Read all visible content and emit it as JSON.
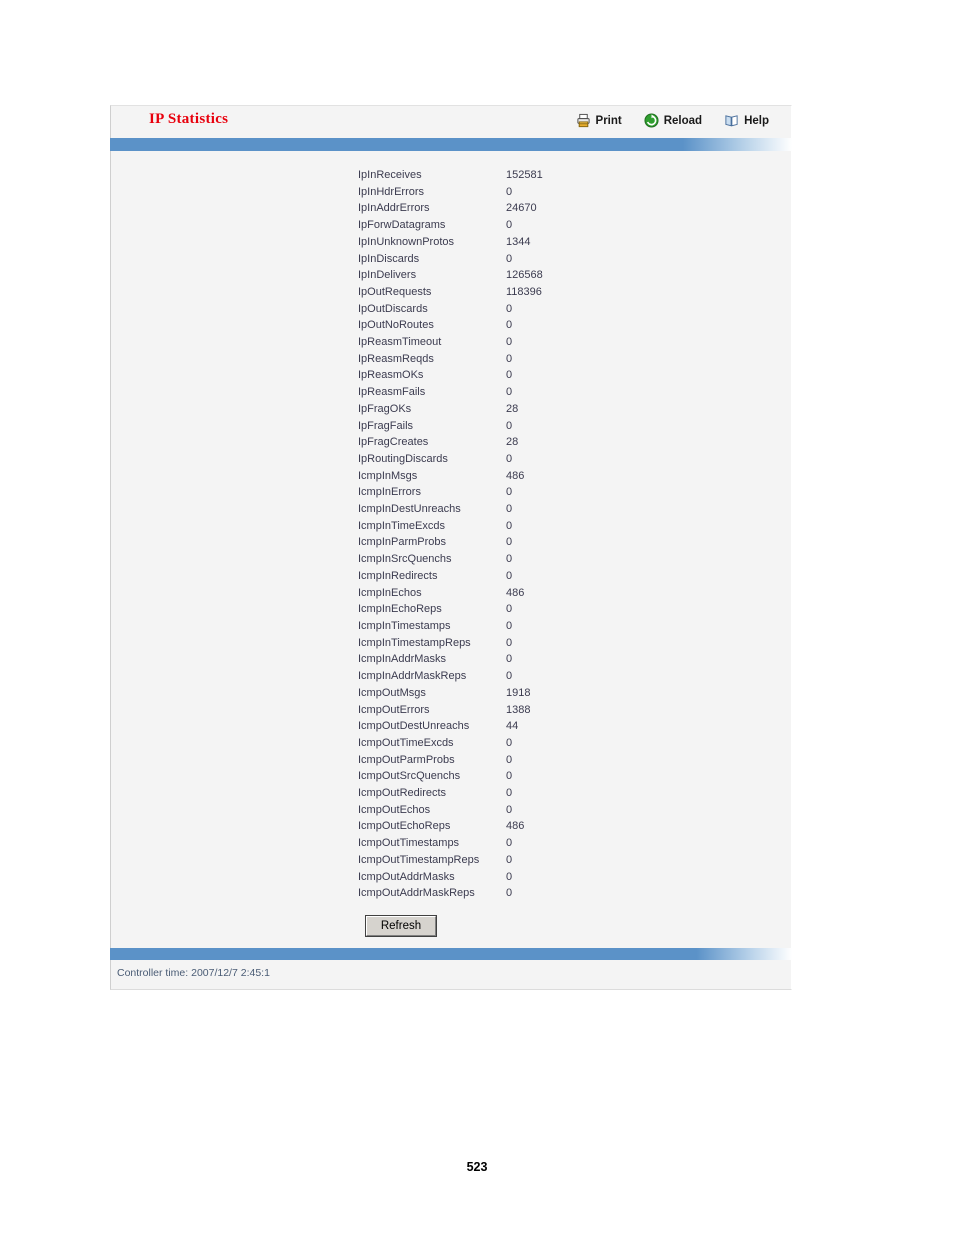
{
  "panel": {
    "title": "IP Statistics",
    "title_color": "#e8000d",
    "accent_color": "#5b92c8",
    "toolbar": [
      {
        "label": "Print",
        "icon": "printer-icon"
      },
      {
        "label": "Reload",
        "icon": "reload-icon"
      },
      {
        "label": "Help",
        "icon": "help-book-icon"
      }
    ],
    "stats": [
      {
        "name": "IpInReceives",
        "value": "152581"
      },
      {
        "name": "IpInHdrErrors",
        "value": "0"
      },
      {
        "name": "IpInAddrErrors",
        "value": "24670"
      },
      {
        "name": "IpForwDatagrams",
        "value": "0"
      },
      {
        "name": "IpInUnknownProtos",
        "value": "1344"
      },
      {
        "name": "IpInDiscards",
        "value": "0"
      },
      {
        "name": "IpInDelivers",
        "value": "126568"
      },
      {
        "name": "IpOutRequests",
        "value": "118396"
      },
      {
        "name": "IpOutDiscards",
        "value": "0"
      },
      {
        "name": "IpOutNoRoutes",
        "value": "0"
      },
      {
        "name": "IpReasmTimeout",
        "value": "0"
      },
      {
        "name": "IpReasmReqds",
        "value": "0"
      },
      {
        "name": "IpReasmOKs",
        "value": "0"
      },
      {
        "name": "IpReasmFails",
        "value": "0"
      },
      {
        "name": "IpFragOKs",
        "value": "28"
      },
      {
        "name": "IpFragFails",
        "value": "0"
      },
      {
        "name": "IpFragCreates",
        "value": "28"
      },
      {
        "name": "IpRoutingDiscards",
        "value": "0"
      },
      {
        "name": "IcmpInMsgs",
        "value": "486"
      },
      {
        "name": "IcmpInErrors",
        "value": "0"
      },
      {
        "name": "IcmpInDestUnreachs",
        "value": "0"
      },
      {
        "name": "IcmpInTimeExcds",
        "value": "0"
      },
      {
        "name": "IcmpInParmProbs",
        "value": "0"
      },
      {
        "name": "IcmpInSrcQuenchs",
        "value": "0"
      },
      {
        "name": "IcmpInRedirects",
        "value": "0"
      },
      {
        "name": "IcmpInEchos",
        "value": "486"
      },
      {
        "name": "IcmpInEchoReps",
        "value": "0"
      },
      {
        "name": "IcmpInTimestamps",
        "value": "0"
      },
      {
        "name": "IcmpInTimestampReps",
        "value": "0"
      },
      {
        "name": "IcmpInAddrMasks",
        "value": "0"
      },
      {
        "name": "IcmpInAddrMaskReps",
        "value": "0"
      },
      {
        "name": "IcmpOutMsgs",
        "value": "1918"
      },
      {
        "name": "IcmpOutErrors",
        "value": "1388"
      },
      {
        "name": "IcmpOutDestUnreachs",
        "value": "44"
      },
      {
        "name": "IcmpOutTimeExcds",
        "value": "0"
      },
      {
        "name": "IcmpOutParmProbs",
        "value": "0"
      },
      {
        "name": "IcmpOutSrcQuenchs",
        "value": "0"
      },
      {
        "name": "IcmpOutRedirects",
        "value": "0"
      },
      {
        "name": "IcmpOutEchos",
        "value": "0"
      },
      {
        "name": "IcmpOutEchoReps",
        "value": "486"
      },
      {
        "name": "IcmpOutTimestamps",
        "value": "0"
      },
      {
        "name": "IcmpOutTimestampReps",
        "value": "0"
      },
      {
        "name": "IcmpOutAddrMasks",
        "value": "0"
      },
      {
        "name": "IcmpOutAddrMaskReps",
        "value": "0"
      }
    ],
    "refresh_label": "Refresh",
    "footer_text": "Controller time: 2007/12/7 2:45:1"
  },
  "document": {
    "page_number": "523"
  }
}
